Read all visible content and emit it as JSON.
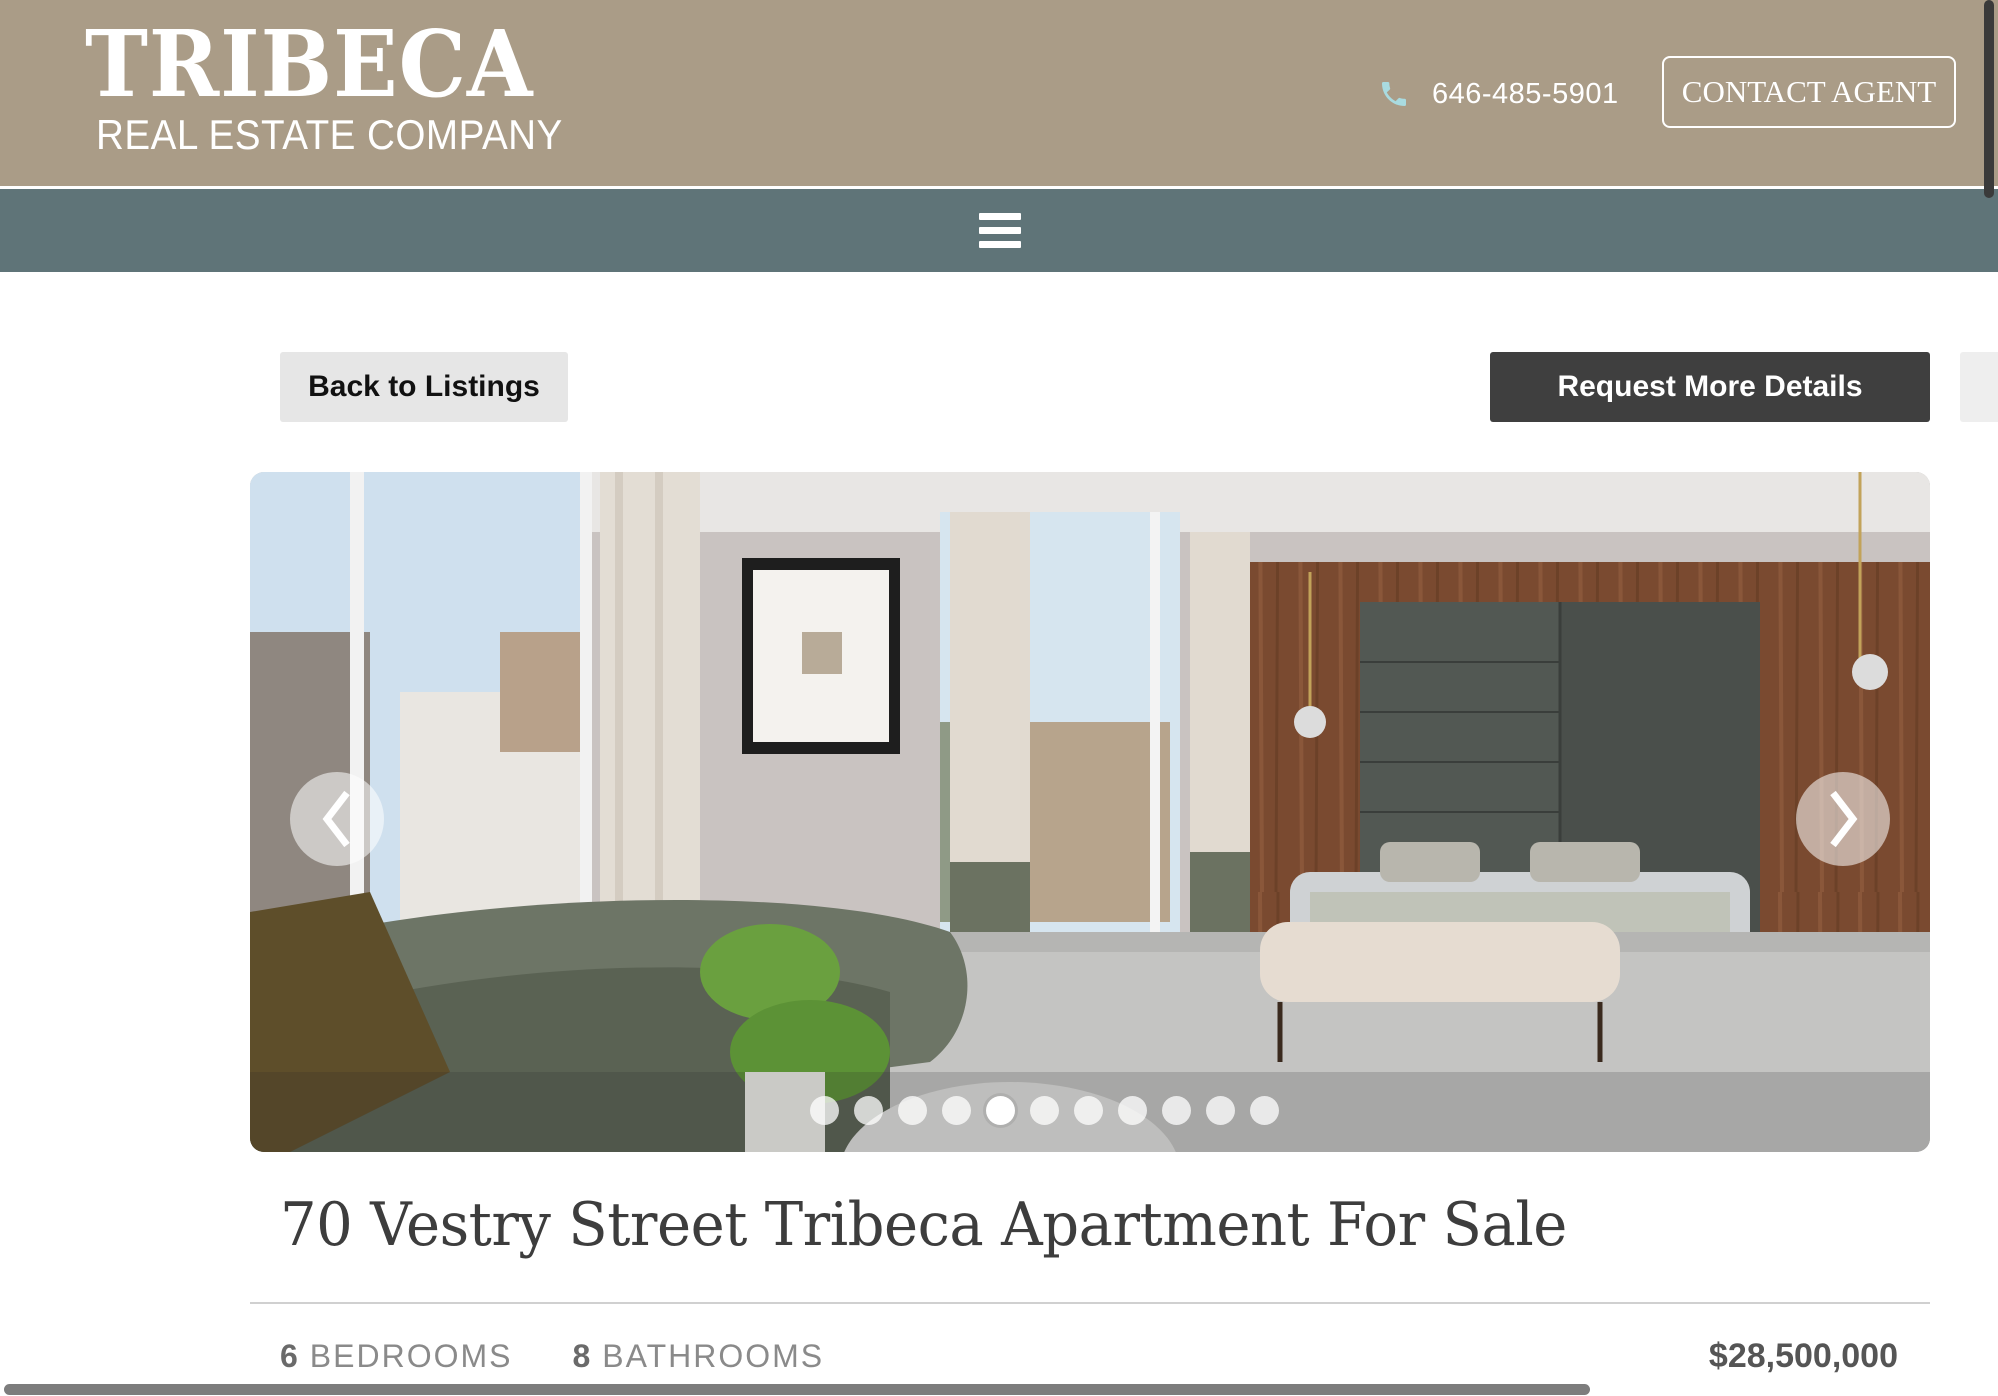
{
  "header": {
    "logo_main": "TRIBECA",
    "logo_sub": "REAL ESTATE COMPANY",
    "phone": "646-485-5901",
    "phone_icon": "phone-icon",
    "contact_label": "CONTACT AGENT",
    "menu_icon": "hamburger-menu-icon"
  },
  "actions": {
    "back_label": "Back to Listings",
    "request_label": "Request More Details"
  },
  "gallery": {
    "prev_icon": "chevron-left-icon",
    "next_icon": "chevron-right-icon",
    "slide_count": 11,
    "active_index": 4
  },
  "listing": {
    "title": "70 Vestry Street Tribeca Apartment For Sale",
    "bedrooms_count": "6",
    "bedrooms_label": "BEDROOMS",
    "bathrooms_count": "8",
    "bathrooms_label": "BATHROOMS",
    "price": "$28,500,000"
  },
  "colors": {
    "header_bg": "#aa9c87",
    "nav_bg": "#5f7478",
    "request_btn": "#3f3f3f",
    "phone_icon": "#a9dbe0"
  }
}
